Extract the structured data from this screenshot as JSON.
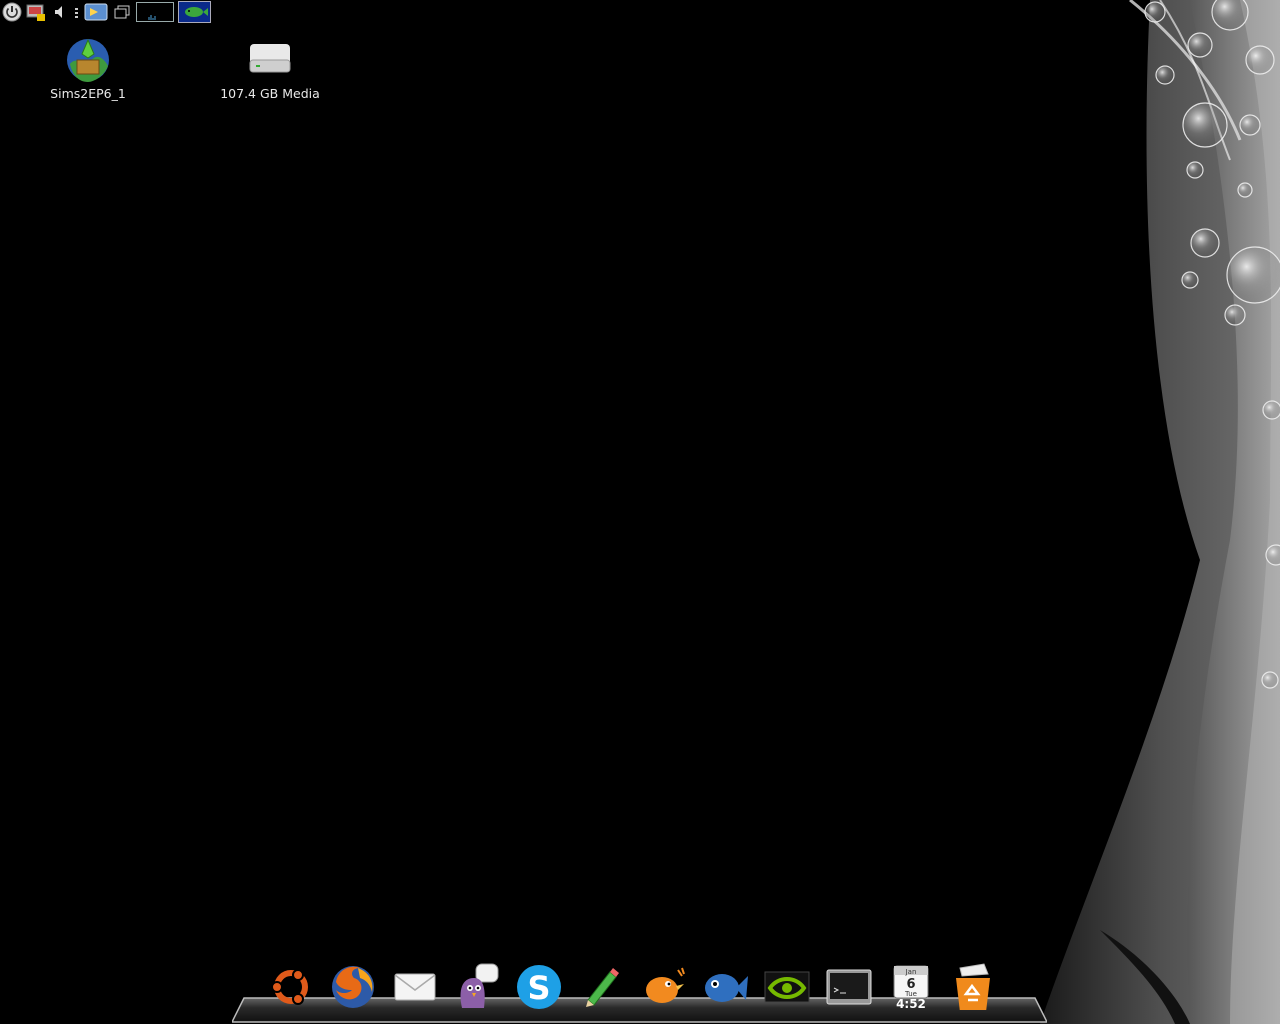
{
  "desktop": {
    "icons": [
      {
        "label": "Sims2EP6_1",
        "icon": "sims-installer-icon"
      },
      {
        "label": "107.4 GB Media",
        "icon": "hard-drive-icon"
      }
    ]
  },
  "top_panel": {
    "items": [
      "power-icon",
      "lock-screen-icon",
      "volume-icon",
      "network-icon",
      "file-manager-icon",
      "windows-icon",
      "system-monitor-graph",
      "fish-applet"
    ]
  },
  "dock": {
    "items": [
      {
        "name": "ubuntu",
        "icon": "ubuntu-logo-icon"
      },
      {
        "name": "firefox",
        "icon": "firefox-icon"
      },
      {
        "name": "mail",
        "icon": "mail-envelope-icon"
      },
      {
        "name": "pidgin",
        "icon": "pidgin-icon"
      },
      {
        "name": "skype",
        "icon": "skype-icon"
      },
      {
        "name": "text-editor",
        "icon": "pencil-icon"
      },
      {
        "name": "twitter-client",
        "icon": "bird-icon"
      },
      {
        "name": "fish",
        "icon": "fish-icon"
      },
      {
        "name": "nvidia-settings",
        "icon": "nvidia-icon"
      },
      {
        "name": "terminal",
        "icon": "terminal-icon"
      },
      {
        "name": "clock-calendar",
        "icon": "calendar-icon"
      },
      {
        "name": "trash",
        "icon": "trash-icon"
      }
    ],
    "calendar": {
      "month": "Jan",
      "day": "6",
      "weekday": "Tue"
    },
    "clock": {
      "time": "4:52"
    }
  },
  "colors": {
    "background": "#000000",
    "wallpaper_swirl": "#8a8a8a",
    "dock_shelf": "#3a3a3a"
  }
}
